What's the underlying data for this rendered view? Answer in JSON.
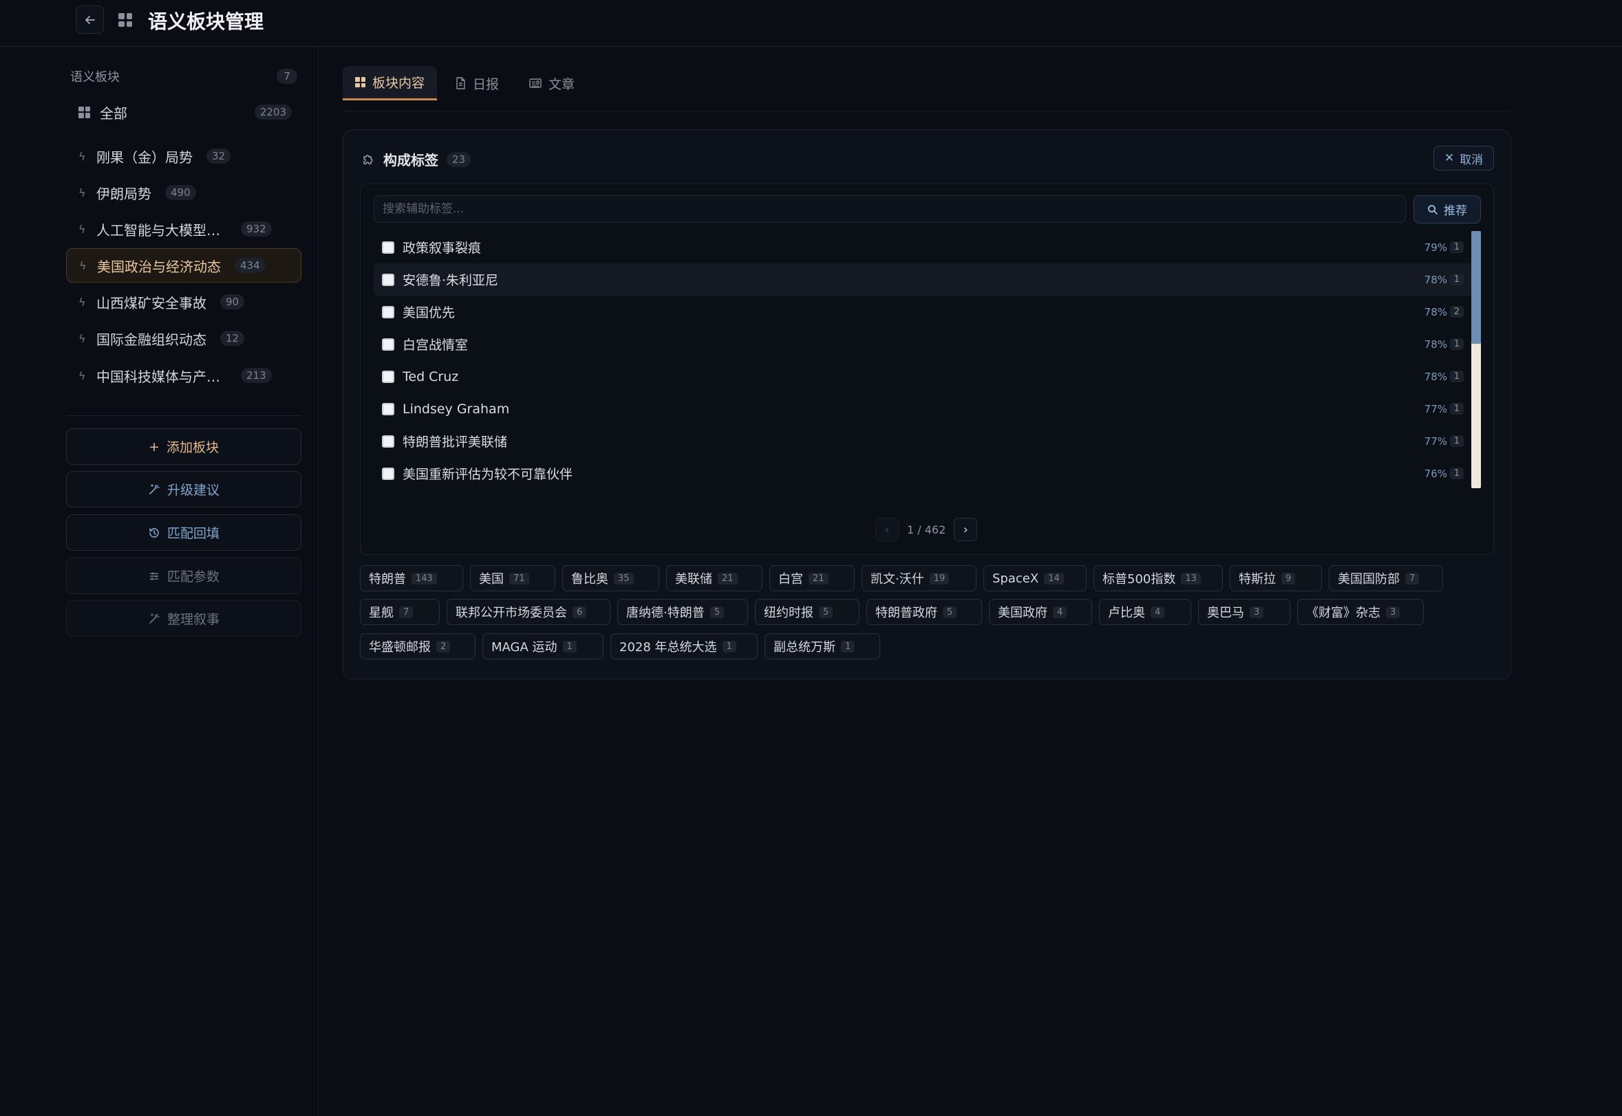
{
  "header": {
    "title": "语义板块管理"
  },
  "sidebar": {
    "heading": "语义板块",
    "heading_count": "7",
    "all": {
      "label": "全部",
      "count": "2203"
    },
    "items": [
      {
        "label": "刚果（金）局势",
        "count": "32"
      },
      {
        "label": "伊朗局势",
        "count": "490"
      },
      {
        "label": "人工智能与大模型技...",
        "count": "932"
      },
      {
        "label": "美国政治与经济动态",
        "count": "434"
      },
      {
        "label": "山西煤矿安全事故",
        "count": "90"
      },
      {
        "label": "国际金融组织动态",
        "count": "12"
      },
      {
        "label": "中国科技媒体与产业...",
        "count": "213"
      }
    ],
    "buttons": {
      "add": "添加板块",
      "upgrade": "升级建议",
      "backfill": "匹配回填",
      "params": "匹配参数",
      "narrative": "整理叙事"
    }
  },
  "tabs": [
    {
      "label": "板块内容"
    },
    {
      "label": "日报"
    },
    {
      "label": "文章"
    }
  ],
  "panel": {
    "title": "构成标签",
    "count": "23",
    "cancel": "取消",
    "search_placeholder": "搜索辅助标签...",
    "recommend": "推荐",
    "rows": [
      {
        "label": "政策叙事裂痕",
        "pct": "79%",
        "n": "1"
      },
      {
        "label": "安德鲁·朱利亚尼",
        "pct": "78%",
        "n": "1"
      },
      {
        "label": "美国优先",
        "pct": "78%",
        "n": "2"
      },
      {
        "label": "白宫战情室",
        "pct": "78%",
        "n": "1"
      },
      {
        "label": "Ted Cruz",
        "pct": "78%",
        "n": "1"
      },
      {
        "label": "Lindsey Graham",
        "pct": "77%",
        "n": "1"
      },
      {
        "label": "特朗普批评美联储",
        "pct": "77%",
        "n": "1"
      },
      {
        "label": "美国重新评估为较不可靠伙伴",
        "pct": "76%",
        "n": "1"
      }
    ],
    "pager": "1 / 462",
    "chips": [
      {
        "label": "特朗普",
        "n": "143"
      },
      {
        "label": "美国",
        "n": "71"
      },
      {
        "label": "鲁比奥",
        "n": "35"
      },
      {
        "label": "美联储",
        "n": "21"
      },
      {
        "label": "白宫",
        "n": "21"
      },
      {
        "label": "凯文·沃什",
        "n": "19"
      },
      {
        "label": "SpaceX",
        "n": "14"
      },
      {
        "label": "标普500指数",
        "n": "13"
      },
      {
        "label": "特斯拉",
        "n": "9"
      },
      {
        "label": "美国国防部",
        "n": "7"
      },
      {
        "label": "星舰",
        "n": "7"
      },
      {
        "label": "联邦公开市场委员会",
        "n": "6"
      },
      {
        "label": "唐纳德·特朗普",
        "n": "5"
      },
      {
        "label": "纽约时报",
        "n": "5"
      },
      {
        "label": "特朗普政府",
        "n": "5"
      },
      {
        "label": "美国政府",
        "n": "4"
      },
      {
        "label": "卢比奥",
        "n": "4"
      },
      {
        "label": "奥巴马",
        "n": "3"
      },
      {
        "label": "《财富》杂志",
        "n": "3"
      },
      {
        "label": "华盛顿邮报",
        "n": "2"
      },
      {
        "label": "MAGA 运动",
        "n": "1"
      },
      {
        "label": "2028 年总统大选",
        "n": "1"
      },
      {
        "label": "副总统万斯",
        "n": "1"
      }
    ]
  },
  "colors": {
    "accent": "#c98a4f",
    "link": "#7fa6cf",
    "bg": "#0a0d14"
  }
}
